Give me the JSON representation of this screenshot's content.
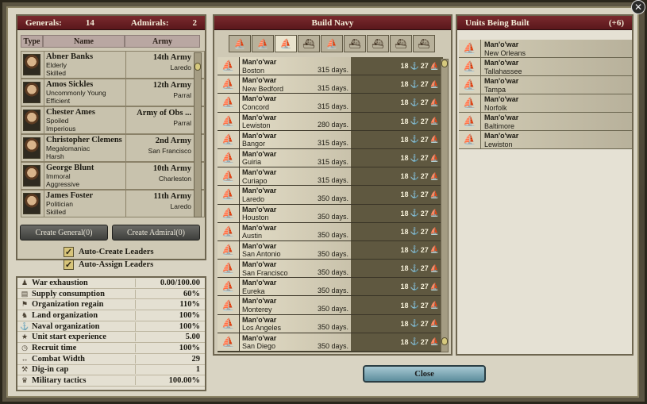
{
  "left": {
    "generals_label": "Generals:",
    "generals_count": "14",
    "admirals_label": "Admirals:",
    "admirals_count": "2",
    "col_type": "Type",
    "col_name": "Name",
    "col_army": "Army",
    "leaders": [
      {
        "name": "Abner Banks",
        "t1": "Elderly",
        "t2": "Skilled",
        "army": "14th Army",
        "loc": "Laredo"
      },
      {
        "name": "Amos Sickles",
        "t1": "Uncommonly Young",
        "t2": "Efficient",
        "army": "12th Army",
        "loc": "Parral"
      },
      {
        "name": "Chester Ames",
        "t1": "Spoiled",
        "t2": "Imperious",
        "army": "Army of Obs ...",
        "loc": "Parral"
      },
      {
        "name": "Christopher Clemens",
        "t1": "Megalomaniac",
        "t2": "Harsh",
        "army": "2nd Army",
        "loc": "San Francisco"
      },
      {
        "name": "George Blunt",
        "t1": "Immoral",
        "t2": "Aggressive",
        "army": "10th Army",
        "loc": "Charleston"
      },
      {
        "name": "James Foster",
        "t1": "Politician",
        "t2": "Skilled",
        "army": "11th Army",
        "loc": "Laredo"
      }
    ],
    "create_general": "Create General(0)",
    "create_admiral": "Create Admiral(0)",
    "auto_create": "Auto-Create Leaders",
    "auto_assign": "Auto-Assign Leaders"
  },
  "stats": [
    {
      "label": "War exhaustion",
      "value": "0.00/100.00",
      "icon": "soldier-icon"
    },
    {
      "label": "Supply consumption",
      "value": "60%",
      "icon": "supply-icon"
    },
    {
      "label": "Organization regain",
      "value": "110%",
      "icon": "organization-icon"
    },
    {
      "label": "Land organization",
      "value": "100%",
      "icon": "land-icon"
    },
    {
      "label": "Naval organization",
      "value": "100%",
      "icon": "naval-icon"
    },
    {
      "label": "Unit start experience",
      "value": "5.00",
      "icon": "experience-icon"
    },
    {
      "label": "Recruit time",
      "value": "100%",
      "icon": "clock-icon"
    },
    {
      "label": "Combat Width",
      "value": "29",
      "icon": "width-icon"
    },
    {
      "label": "Dig-in cap",
      "value": "1",
      "icon": "shovel-icon"
    },
    {
      "label": "Military tactics",
      "value": "100.00%",
      "icon": "tactics-icon"
    }
  ],
  "build_navy": {
    "title": "Build Navy",
    "ships": [
      {
        "name": "Man'o'war",
        "city": "Boston",
        "days": "315 days."
      },
      {
        "name": "Man'o'war",
        "city": "New Bedford",
        "days": "315 days."
      },
      {
        "name": "Man'o'war",
        "city": "Concord",
        "days": "315 days."
      },
      {
        "name": "Man'o'war",
        "city": "Lewiston",
        "days": "280 days."
      },
      {
        "name": "Man'o'war",
        "city": "Bangor",
        "days": "315 days."
      },
      {
        "name": "Man'o'war",
        "city": "Guiria",
        "days": "315 days."
      },
      {
        "name": "Man'o'war",
        "city": "Curiapo",
        "days": "315 days."
      },
      {
        "name": "Man'o'war",
        "city": "Laredo",
        "days": "350 days."
      },
      {
        "name": "Man'o'war",
        "city": "Houston",
        "days": "350 days."
      },
      {
        "name": "Man'o'war",
        "city": "Austin",
        "days": "350 days."
      },
      {
        "name": "Man'o'war",
        "city": "San Antonio",
        "days": "350 days."
      },
      {
        "name": "Man'o'war",
        "city": "San Francisco",
        "days": "350 days."
      },
      {
        "name": "Man'o'war",
        "city": "Eureka",
        "days": "350 days."
      },
      {
        "name": "Man'o'war",
        "city": "Monterey",
        "days": "350 days."
      },
      {
        "name": "Man'o'war",
        "city": "Los Angeles",
        "days": "350 days."
      },
      {
        "name": "Man'o'war",
        "city": "San Diego",
        "days": "350 days."
      }
    ],
    "stat_a": "18",
    "stat_b": "27"
  },
  "units_built": {
    "title": "Units Being Built",
    "count": "(+6)",
    "units": [
      {
        "name": "Man'o'war",
        "city": "New Orleans"
      },
      {
        "name": "Man'o'war",
        "city": "Tallahassee"
      },
      {
        "name": "Man'o'war",
        "city": "Tampa"
      },
      {
        "name": "Man'o'war",
        "city": "Norfolk"
      },
      {
        "name": "Man'o'war",
        "city": "Baltimore"
      },
      {
        "name": "Man'o'war",
        "city": "Lewiston"
      }
    ]
  },
  "close_label": "Close"
}
